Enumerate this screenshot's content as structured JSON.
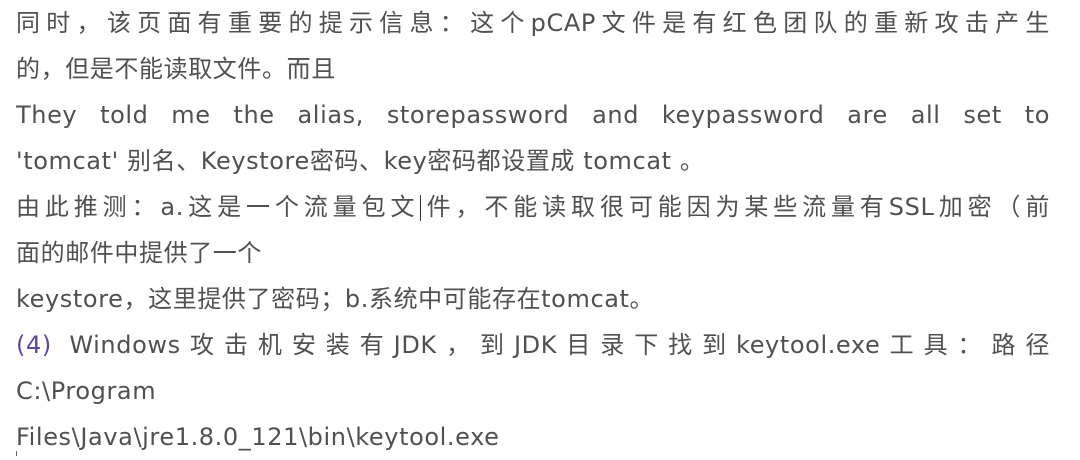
{
  "document": {
    "para1": {
      "line1": "同时，该页面有重要的提示信息：这个pCAP文件是有红色团队的重新攻击产生",
      "line2": "的，但是不能读取文件。而且"
    },
    "para2": {
      "line1": "They told me the alias, storepassword and keypassword are all set to",
      "line2": "'tomcat' 别名、Keystore密码、key密码都设置成 tomcat  。"
    },
    "para3": {
      "line1_before_caret": "由此推测：a.这是一个流量包文",
      "line1_after_caret": "件，不能读取很可能因为某些流量有SSL加密（前",
      "line2": "面的邮件中提供了一个",
      "line3": "keystore，这里提供了密码；b.系统中可能存在tomcat。"
    },
    "para4": {
      "number": "(4)",
      "line1": " Windows攻击机安装有JDK，到JDK目录下找到keytool.exe工具：路径",
      "line2": "C:\\Program",
      "line3": "Files\\Java\\jre1.8.0_121\\bin\\keytool.exe"
    }
  },
  "colors": {
    "text": "#505050",
    "list_number": "#5a4a9c",
    "background": "#ffffff"
  }
}
